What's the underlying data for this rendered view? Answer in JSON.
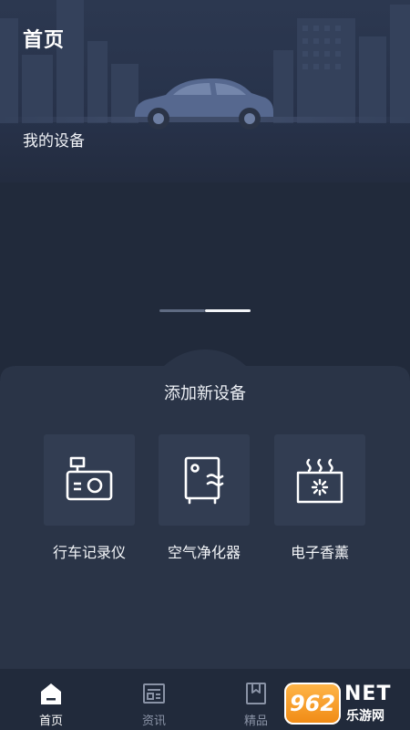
{
  "header": {
    "title": "首页",
    "section_title": "我的设备"
  },
  "carousel": {
    "page_count": 2,
    "active_index": 1
  },
  "add_panel": {
    "title": "添加新设备",
    "devices": [
      {
        "label": "行车记录仪",
        "icon": "dashcam-icon"
      },
      {
        "label": "空气净化器",
        "icon": "air-purifier-icon"
      },
      {
        "label": "电子香薰",
        "icon": "aroma-diffuser-icon"
      }
    ]
  },
  "tabbar": {
    "tabs": [
      {
        "label": "首页",
        "icon": "home-icon",
        "active": true
      },
      {
        "label": "资讯",
        "icon": "news-icon",
        "active": false
      },
      {
        "label": "精品",
        "icon": "bookmark-icon",
        "active": false
      }
    ]
  },
  "watermark": {
    "badge": "962",
    "brand": "NET",
    "sub": "乐游网"
  },
  "colors": {
    "background": "#212a3b",
    "tile": "#323d52",
    "text": "#ffffff",
    "muted": "#8a93a6",
    "watermark_orange": "#f08a14"
  }
}
